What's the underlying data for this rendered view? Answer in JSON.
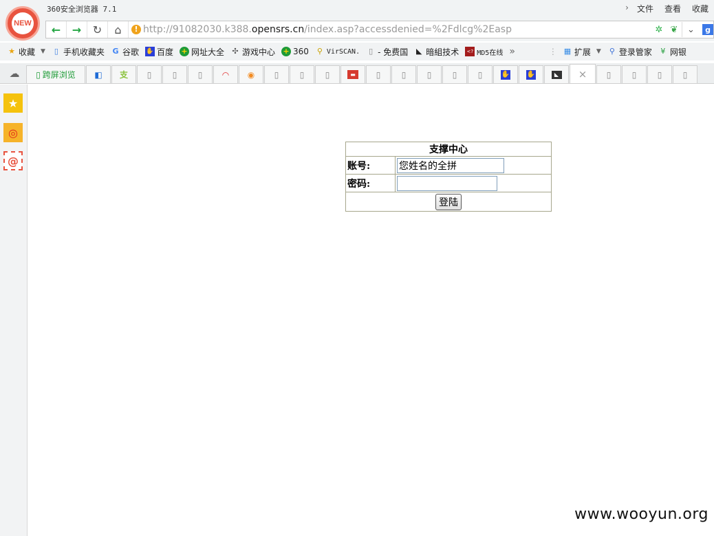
{
  "app": {
    "title": "360安全浏览器 7.1",
    "logo_text": "NEW",
    "menu": [
      "文件",
      "查看",
      "收藏"
    ]
  },
  "address_bar": {
    "url_prefix": "http://91082030.k388.",
    "url_host": "opensrs.cn",
    "url_path": "/index.asp?accessdenied=%2Fdlcg%2Easp",
    "search_engine_icon": "g"
  },
  "bookmarks": {
    "favorites_label": "收藏",
    "items": [
      {
        "label": "手机收藏夹",
        "icon": "phone-icon"
      },
      {
        "label": "谷歌",
        "icon": "google-icon"
      },
      {
        "label": "百度",
        "icon": "baidu-icon"
      },
      {
        "label": "网址大全",
        "icon": "360-nav-icon"
      },
      {
        "label": "游戏中心",
        "icon": "gamepad-icon"
      },
      {
        "label": "360",
        "icon": "360-icon"
      },
      {
        "label": "VirSCAN.",
        "icon": "virscan-icon"
      },
      {
        "label": "- 免费国",
        "icon": "page-icon"
      },
      {
        "label": "暗組技术",
        "icon": "darkgroup-icon"
      },
      {
        "label": "MD5在线",
        "icon": "md5-icon"
      }
    ],
    "more": "»",
    "right": [
      {
        "label": "扩展",
        "icon": "extensions-icon"
      },
      {
        "label": "登录管家",
        "icon": "login-manager-icon"
      },
      {
        "label": "网银",
        "icon": "bank-icon"
      }
    ]
  },
  "tabs": {
    "first_tab_label": "跨屏浏览",
    "close_symbol": "×"
  },
  "login": {
    "title": "支撑中心",
    "account_label": "账号:",
    "account_value": "您姓名的全拼",
    "password_label": "密码:",
    "password_value": "",
    "submit_label": "登陆"
  },
  "watermark": "www.wooyun.org"
}
